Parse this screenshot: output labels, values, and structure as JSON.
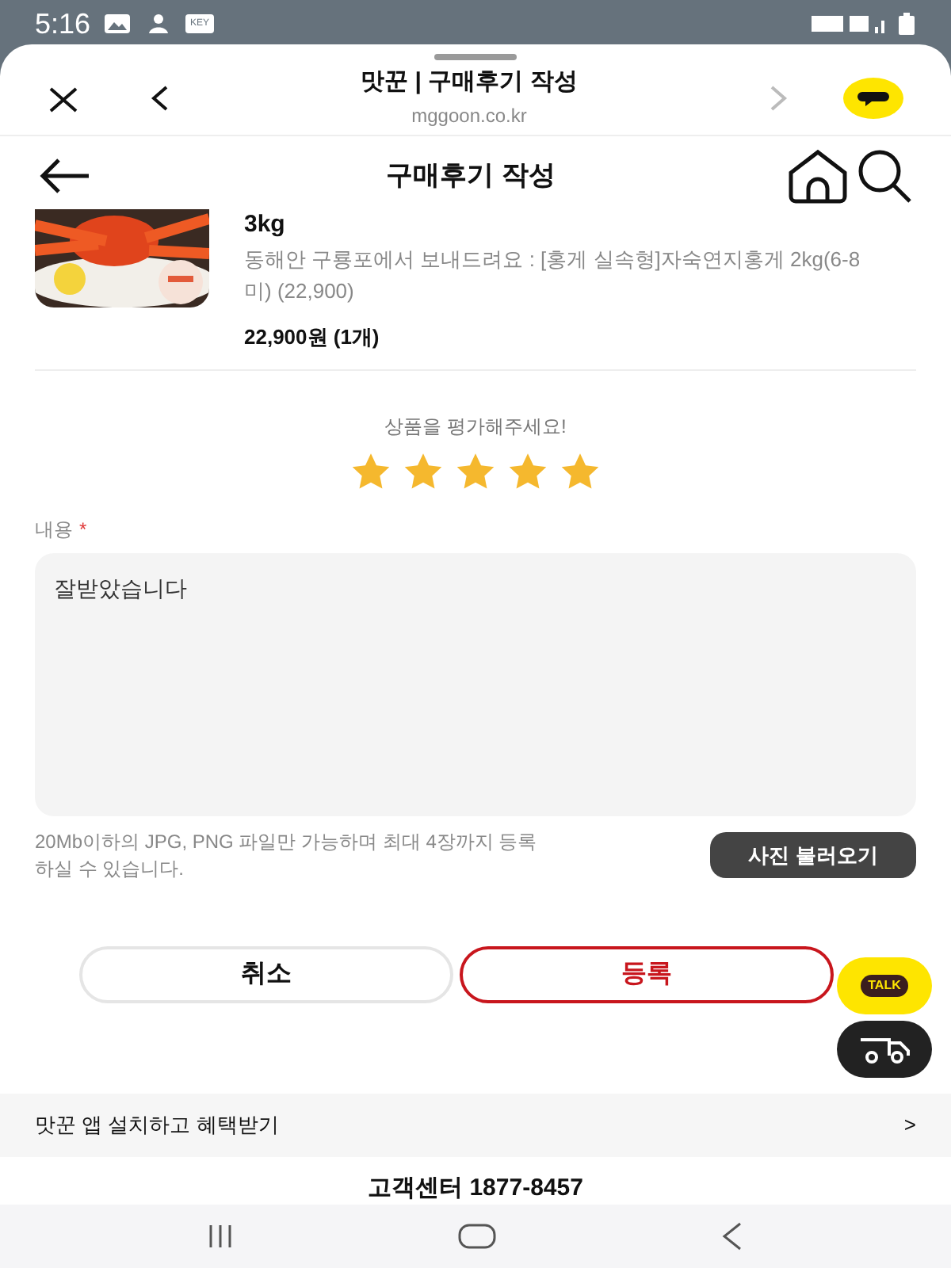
{
  "status_bar": {
    "time": "5:16",
    "key_badge": "KEY"
  },
  "browser_bar": {
    "title": "맛꾼 | 구매후기 작성",
    "url": "mggoon.co.kr"
  },
  "header": {
    "title": "구매후기 작성"
  },
  "product": {
    "name_tail": "3kg",
    "option": "동해안 구룡포에서 보내드려요 : [홍게 실속형]자숙연지홍게 2kg(6-8미) (22,900)",
    "price": "22,900원 (1개)"
  },
  "rating": {
    "prompt": "상품을 평가해주세요!",
    "stars": 5
  },
  "content": {
    "label": "내용",
    "required_mark": "*",
    "value": "잘받았습니다"
  },
  "upload": {
    "hint": "20Mb이하의 JPG, PNG 파일만 가능하며 최대 4장까지 등록하실 수 있습니다.",
    "button": "사진 불러오기"
  },
  "actions": [
    {
      "label": "취소",
      "kind": "cancel"
    },
    {
      "label": "등록",
      "kind": "submit"
    }
  ],
  "floating": {
    "talk": "TALK"
  },
  "app_banner": {
    "text": "맛꾼 앱 설치하고 혜택받기",
    "arrow": ">"
  },
  "footer": {
    "customer_center": "고객센터 1877-8457"
  }
}
